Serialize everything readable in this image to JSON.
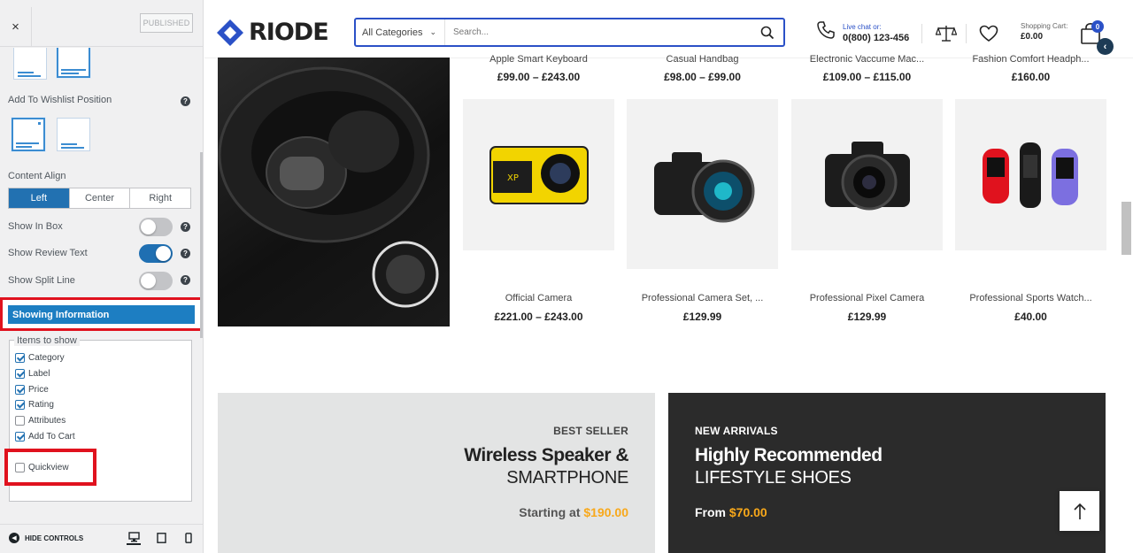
{
  "panel": {
    "close_symbol": "×",
    "published_label": "PUBLISHED",
    "wishlist_position_label": "Add To Wishlist Position",
    "content_align_label": "Content Align",
    "align_options": [
      "Left",
      "Center",
      "Right"
    ],
    "align_selected": "Left",
    "toggles": [
      {
        "label": "Show In Box",
        "on": false
      },
      {
        "label": "Show Review Text",
        "on": true
      },
      {
        "label": "Show Split Line",
        "on": false
      }
    ],
    "section_title": "Showing Information",
    "items_legend": "Items to show",
    "items": [
      {
        "label": "Category",
        "checked": true
      },
      {
        "label": "Label",
        "checked": true
      },
      {
        "label": "Price",
        "checked": true
      },
      {
        "label": "Rating",
        "checked": true
      },
      {
        "label": "Attributes",
        "checked": false
      },
      {
        "label": "Add To Cart",
        "checked": true
      },
      {
        "label": "Quickview",
        "checked": false
      }
    ],
    "hide_controls_label": "HIDE CONTROLS",
    "devices": [
      "desktop-icon",
      "tablet-icon",
      "mobile-icon"
    ],
    "accent_color": "#2271b1",
    "highlight_color": "#e0121e"
  },
  "header": {
    "logo_text": "RIODE",
    "search_category": "All Categories",
    "search_placeholder": "Search...",
    "phone_small": "Live chat or:",
    "phone_number": "0(800) 123-456",
    "cart_label": "Shopping Cart:",
    "cart_total": "£0.00",
    "cart_count": "0",
    "brand_color": "#2b51c7"
  },
  "products_top": [
    {
      "name": "Apple Smart Keyboard",
      "price": "£99.00 – £243.00"
    },
    {
      "name": "Casual Handbag",
      "price": "£98.00 – £99.00"
    },
    {
      "name": "Electronic Vaccume Mac...",
      "price": "£109.00 – £115.00"
    },
    {
      "name": "Fashion Comfort Headph...",
      "price": "£160.00"
    }
  ],
  "products": [
    {
      "name": "Official Camera",
      "price": "£221.00 – £243.00",
      "icon": "action-camera-icon"
    },
    {
      "name": "Professional Camera Set, ...",
      "price": "£129.99",
      "icon": "dslr-camera-icon"
    },
    {
      "name": "Professional Pixel Camera",
      "price": "£129.99",
      "icon": "dslr-camera-icon"
    },
    {
      "name": "Professional Sports Watch...",
      "price": "£40.00",
      "icon": "fitness-band-icon"
    }
  ],
  "banners": [
    {
      "tag": "BEST SELLER",
      "title": "Wireless Speaker &",
      "subtitle": "SMARTPHONE",
      "price_prefix": "Starting at",
      "price": "$190.00"
    },
    {
      "tag": "NEW ARRIVALS",
      "title": "Highly Recommended",
      "subtitle": "LIFESTYLE SHOES",
      "price_prefix": "From",
      "price": "$70.00"
    }
  ]
}
